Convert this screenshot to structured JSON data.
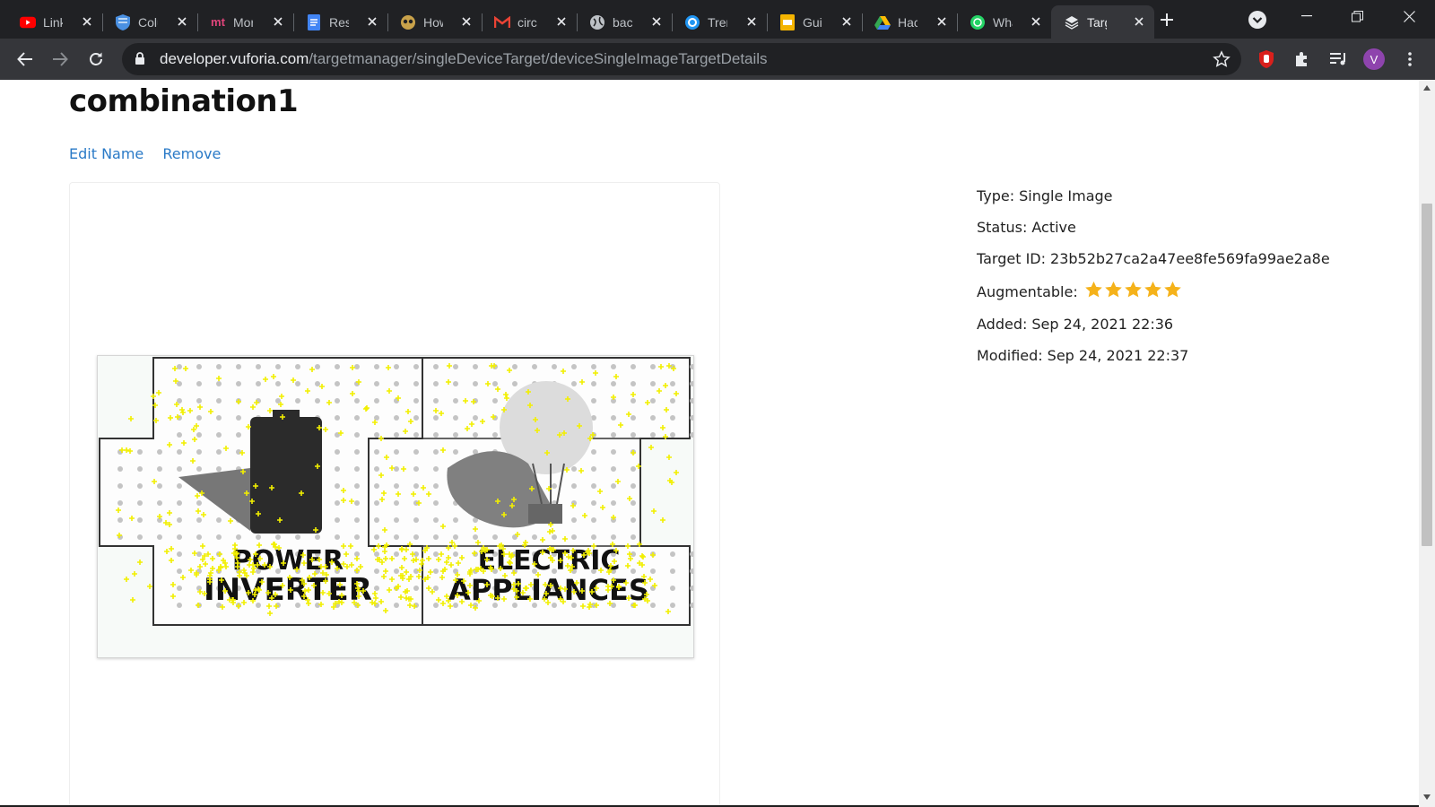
{
  "browser": {
    "tabs": [
      {
        "label": "Link",
        "icon": "youtube-icon",
        "color": "#ff0000"
      },
      {
        "label": "Colu",
        "icon": "shield-icon",
        "color": "#4a90e2"
      },
      {
        "label": "Mor",
        "icon": "mt-logo-icon",
        "color": "#e0457b"
      },
      {
        "label": "Resi",
        "icon": "docs-icon",
        "color": "#4285f4"
      },
      {
        "label": "How",
        "icon": "owl-icon",
        "color": "#c9a24a"
      },
      {
        "label": "circ",
        "icon": "gmail-icon",
        "color": "#ea4335"
      },
      {
        "label": "bacl",
        "icon": "globe-icon",
        "color": "#bdc1c6"
      },
      {
        "label": "Trer",
        "icon": "circle-c-icon",
        "color": "#2196f3"
      },
      {
        "label": "Guid",
        "icon": "slides-icon",
        "color": "#f4b400"
      },
      {
        "label": "Hac",
        "icon": "drive-icon",
        "color": "#34a853"
      },
      {
        "label": "Wha",
        "icon": "whatsapp-icon",
        "color": "#25d366"
      },
      {
        "label": "Targ",
        "icon": "vuforia-icon",
        "color": "#e8eaed",
        "active": true
      }
    ],
    "url_host": "developer.vuforia.com",
    "url_path": "/targetmanager/singleDeviceTarget/deviceSingleImageTargetDetails",
    "profile_initial": "V"
  },
  "target": {
    "name": "combination1",
    "edit_label": "Edit Name",
    "remove_label": "Remove",
    "image_text_left": [
      "POWER",
      "INVERTER"
    ],
    "image_text_right": [
      "ELECTRIC",
      "APPLIANCES"
    ],
    "type_label": "Type:",
    "type_value": "Single Image",
    "status_label": "Status:",
    "status_value": "Active",
    "id_label": "Target ID:",
    "id_value": "23b52b27ca2a47ee8fe569fa99ae2a8e",
    "augmentable_label": "Augmentable:",
    "augmentable_rating": 5,
    "augmentable_max": 5,
    "added_label": "Added:",
    "added_value": "Sep 24, 2021 22:36",
    "modified_label": "Modified:",
    "modified_value": "Sep 24, 2021 22:37"
  },
  "colors": {
    "link": "#2a7ac7",
    "star": "#f5b21a",
    "feature_point": "#f2ef00"
  }
}
